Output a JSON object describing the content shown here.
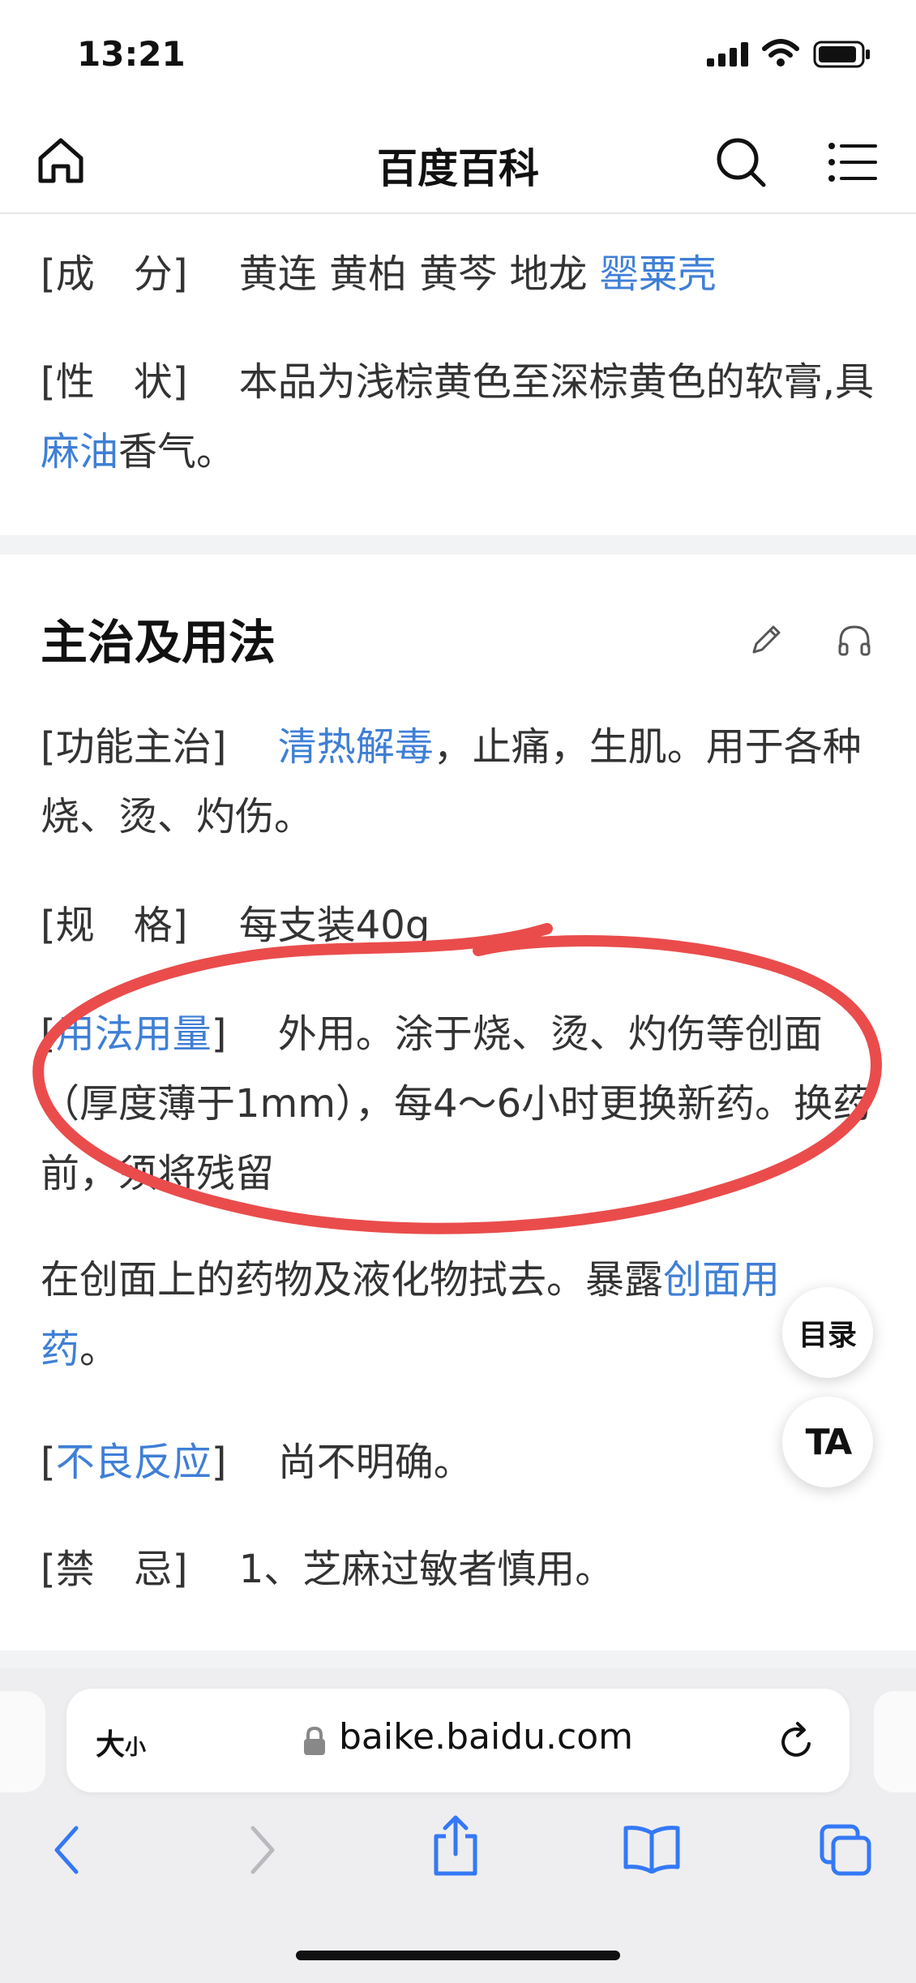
{
  "status_bar": {
    "time": "13:21"
  },
  "nav": {
    "title": "百度百科"
  },
  "top": {
    "ingredients_label": "[成　分]",
    "ingredients_text": "黄连 黄柏 黄芩 地龙 ",
    "ingredients_link": "罂粟壳",
    "properties_label": "[性　状]",
    "properties_text1": "本品为浅棕黄色至深棕黄色的软膏,具",
    "properties_link": "麻油",
    "properties_text2": "香气。"
  },
  "section": {
    "title": "主治及用法",
    "indications_label": "[功能主治]",
    "indications_link": "清热解毒",
    "indications_text": "，止痛，生肌。用于各种烧、烫、灼伤。",
    "spec_label": "[规　格]",
    "spec_text": "每支装40g",
    "usage_bracket_open": "[",
    "usage_link": "用法用量",
    "usage_bracket_close": "]",
    "usage_text": "外用。涂于烧、烫、灼伤等创面（厚度薄于1mm），每4～6小时更换新药。换药前，须将残留",
    "usage_text_cont": "在创面上的药物及液化物拭去。暴露",
    "usage_link2": "创面用药",
    "usage_text_end": "。",
    "adverse_bracket_open": "[",
    "adverse_link": "不良反应",
    "adverse_bracket_close": "]",
    "adverse_text": "尚不明确。",
    "contra_label": "[禁　忌]",
    "contra_text": "1、芝麻过敏者慎用。"
  },
  "fab": {
    "toc": "目录",
    "font": "TA"
  },
  "browser": {
    "size_label_big": "大",
    "size_label_small": "小",
    "url": "baike.baidu.com"
  },
  "colors": {
    "link": "#3f7fd6",
    "annotation": "#ea4c4c",
    "accent": "#3478f6"
  },
  "icons": [
    "home-icon",
    "search-icon",
    "menu-icon",
    "edit-icon",
    "audio-icon",
    "lock-icon",
    "reload-icon",
    "back-icon",
    "forward-icon",
    "share-icon",
    "bookmarks-icon",
    "tabs-icon"
  ]
}
